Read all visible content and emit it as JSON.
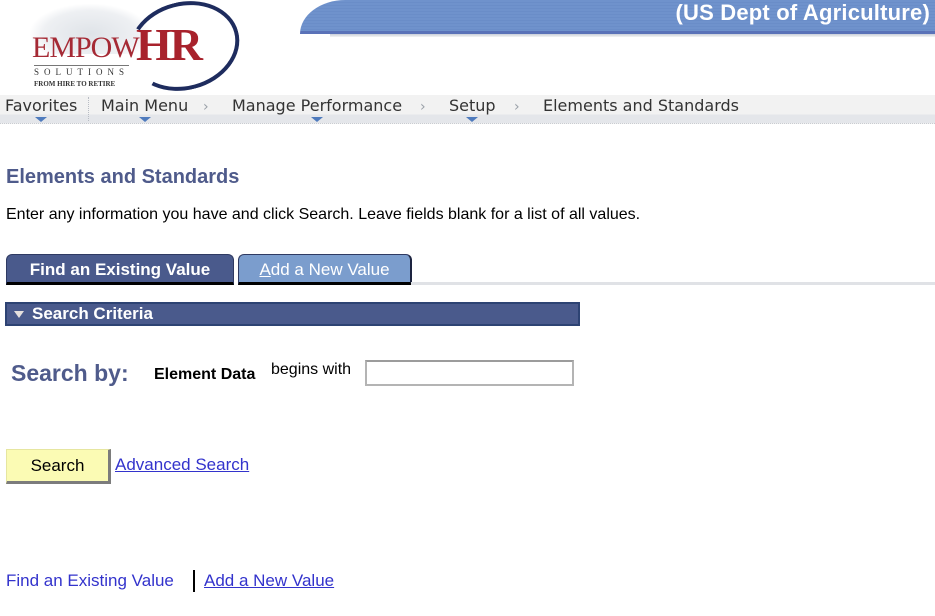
{
  "header": {
    "org_title": "(US Dept of Agriculture)",
    "logo": {
      "brand_left": "EMPOW",
      "brand_right": "HR",
      "solutions": "SOLUTIONS",
      "tagline": "FROM HIRE TO RETIRE"
    }
  },
  "nav": {
    "items": [
      {
        "label": "Favorites",
        "has_dropdown": true
      },
      {
        "label": "Main Menu",
        "has_dropdown": true
      },
      {
        "label": "Manage Performance",
        "has_dropdown": true
      },
      {
        "label": "Setup",
        "has_dropdown": true
      },
      {
        "label": "Elements and Standards",
        "has_dropdown": false
      }
    ],
    "separator": "›"
  },
  "page": {
    "title": "Elements and Standards",
    "instructions": "Enter any information you have and click Search. Leave fields blank for a list of all values."
  },
  "tabs": [
    {
      "label": "Find an Existing Value",
      "active": true
    },
    {
      "label_underlined": "A",
      "label_rest": "dd a New Value",
      "label": "Add a New Value",
      "active": false
    }
  ],
  "search_criteria": {
    "header": "Search Criteria",
    "search_by_label": "Search by:",
    "field_label": "Element Data",
    "operator": "begins with",
    "input_value": ""
  },
  "actions": {
    "search_button": "Search",
    "advanced_search_link": "Advanced Search"
  },
  "footer_links": {
    "find": "Find an Existing Value",
    "add": "Add a New Value"
  },
  "colors": {
    "header_band": "#6f92cc",
    "title_text": "#4f5b8b",
    "section_header_bg": "#4a5a8c",
    "active_tab_bg": "#4a5a8c",
    "inactive_tab_bg": "#7b9dcd",
    "search_button_bg": "#fbfbb4",
    "link": "#3333cc"
  }
}
